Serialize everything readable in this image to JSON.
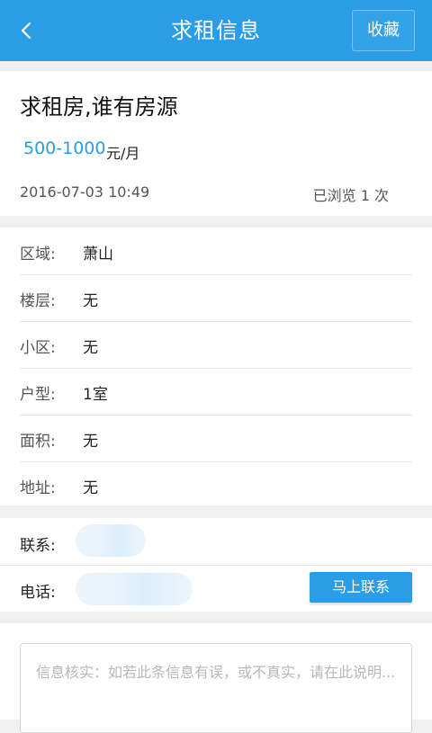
{
  "header": {
    "title": "求租信息",
    "favorite_label": "收藏"
  },
  "listing": {
    "title": "求租房,谁有房源",
    "price": "500-1000",
    "price_unit": "元/月",
    "time": "2016-07-03 10:49",
    "views": "已浏览 1 次"
  },
  "details": [
    {
      "label": "区域:",
      "value": "萧山"
    },
    {
      "label": "楼层:",
      "value": "无"
    },
    {
      "label": "小区:",
      "value": "无"
    },
    {
      "label": "户型:",
      "value": "1室"
    },
    {
      "label": "面积:",
      "value": "无"
    },
    {
      "label": "地址:",
      "value": "无"
    }
  ],
  "contact": {
    "contact_label": "联系:",
    "phone_label": "电话:",
    "call_button": "马上联系"
  },
  "note": {
    "placeholder": "信息核实：如若此条信息有误，或不真实，请在此说明..."
  },
  "colors": {
    "accent": "#2a9de6"
  }
}
